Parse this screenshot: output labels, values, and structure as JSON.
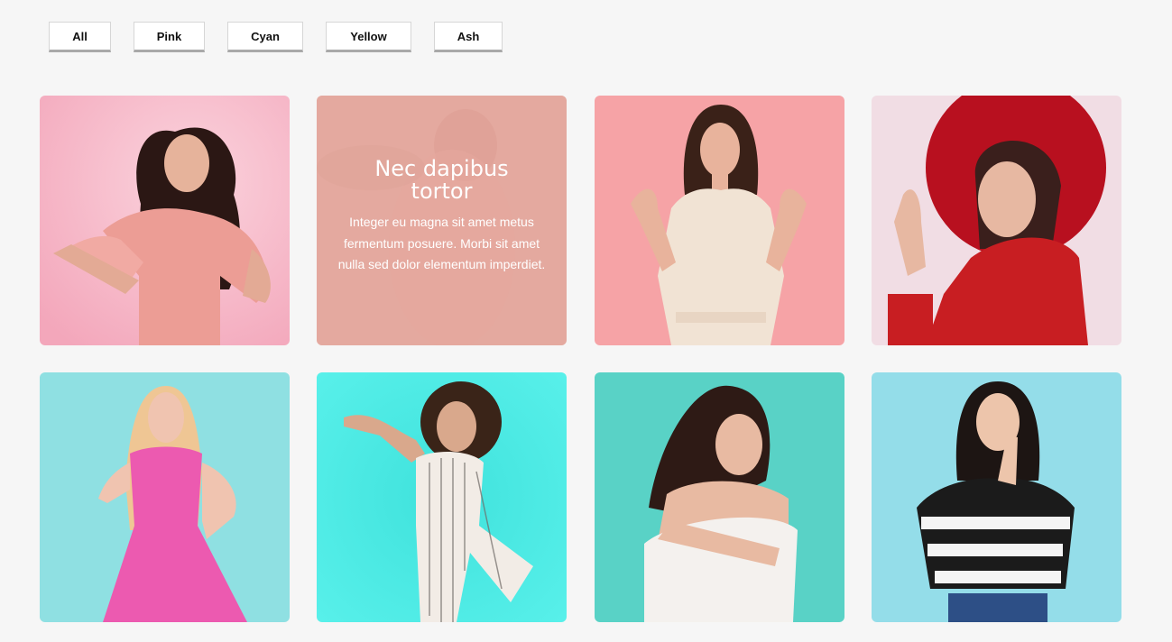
{
  "filters": [
    {
      "label": "All",
      "active": true
    },
    {
      "label": "Pink",
      "active": false
    },
    {
      "label": "Cyan",
      "active": false
    },
    {
      "label": "Yellow",
      "active": false
    },
    {
      "label": "Ash",
      "active": false
    }
  ],
  "gallery": {
    "items": [
      {
        "category": "Pink",
        "image": "woman-curly-hair-pink-blouse",
        "bg": "#f7bdc9",
        "hovered": false
      },
      {
        "category": "Pink",
        "image": "woman-pink-blurred",
        "bg": "#e8aba0",
        "hovered": true,
        "overlay": {
          "title": "Nec dapibus tortor",
          "text": "Integer eu magna sit amet metus fermentum posuere. Morbi sit amet nulla sed dolor elementum imperdiet."
        }
      },
      {
        "category": "Pink",
        "image": "woman-ok-gesture-cream-dress",
        "bg": "#f6a3a6",
        "hovered": false
      },
      {
        "category": "Pink",
        "image": "woman-red-hat",
        "bg": "#f1dde4",
        "hovered": false
      },
      {
        "category": "Cyan",
        "image": "blonde-pink-dress",
        "bg": "#8fe0e2",
        "hovered": false
      },
      {
        "category": "Cyan",
        "image": "curly-striped-jumpsuit",
        "bg": "#3ee8e2",
        "hovered": false
      },
      {
        "category": "Cyan",
        "image": "woman-off-shoulder-white-top",
        "bg": "#59d2c6",
        "hovered": false
      },
      {
        "category": "Cyan",
        "image": "woman-shush-striped-top",
        "bg": "#94dde9",
        "hovered": false
      }
    ]
  },
  "colors": {
    "page_bg": "#f6f6f6",
    "button_border": "#a9a9a9"
  }
}
